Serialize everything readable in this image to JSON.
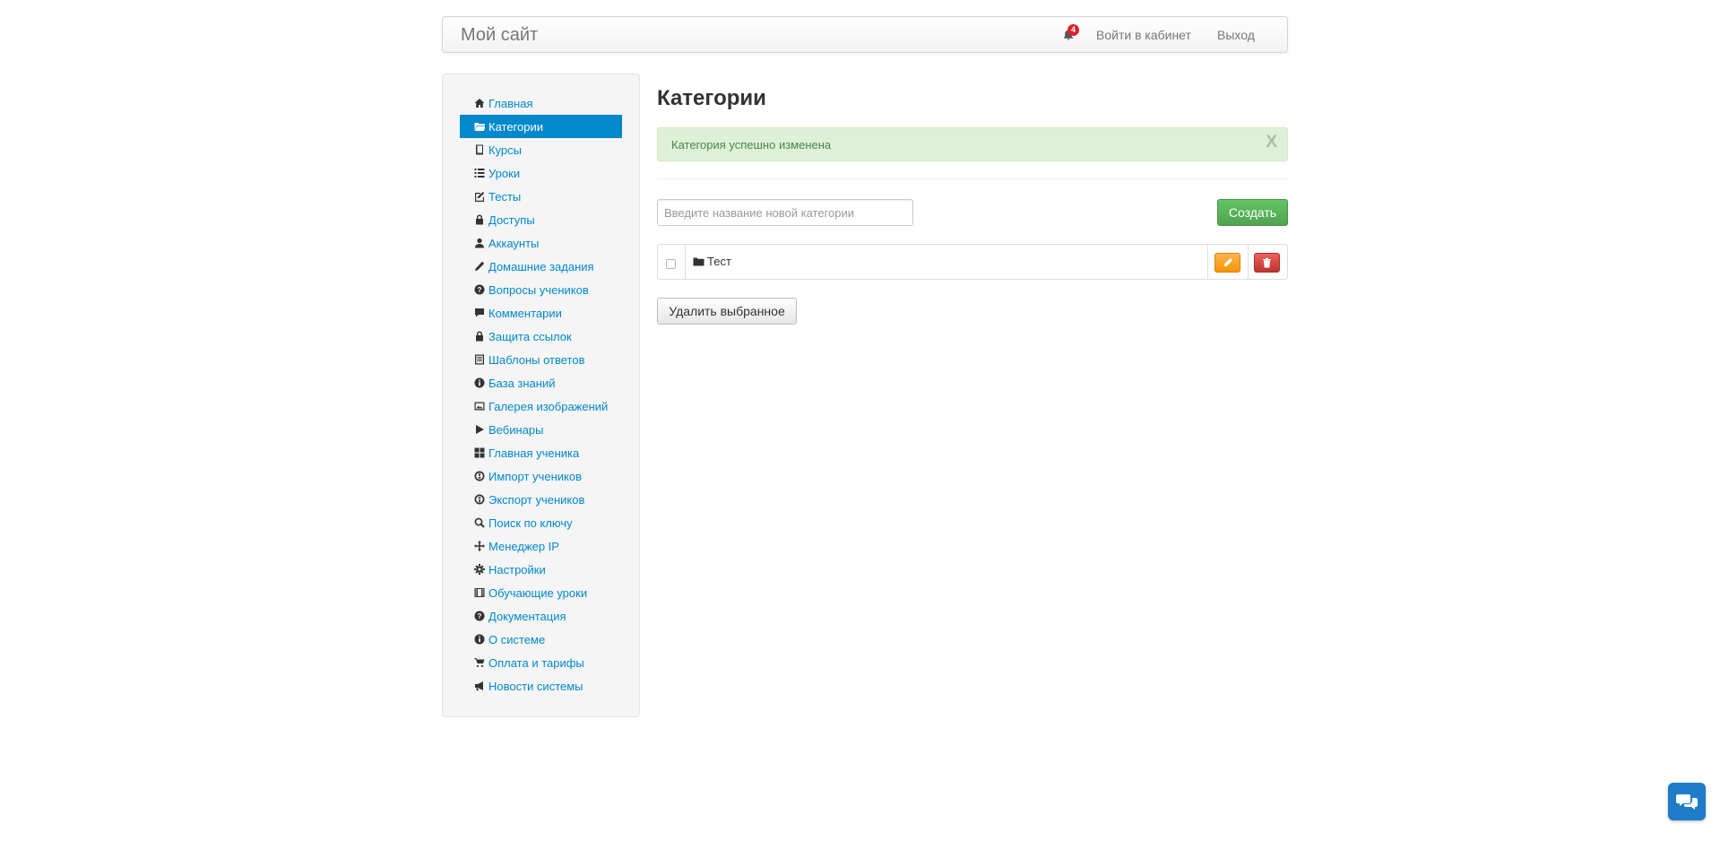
{
  "navbar": {
    "brand": "Мой сайт",
    "notification_count": "4",
    "login_label": "Войти в кабинет",
    "logout_label": "Выход"
  },
  "sidebar": {
    "items": [
      {
        "label": "Главная",
        "icon": "home-icon",
        "active": false
      },
      {
        "label": "Категории",
        "icon": "folder-open-icon",
        "active": true
      },
      {
        "label": "Курсы",
        "icon": "book-icon",
        "active": false
      },
      {
        "label": "Уроки",
        "icon": "list-icon",
        "active": false
      },
      {
        "label": "Тесты",
        "icon": "edit-check-icon",
        "active": false
      },
      {
        "label": "Доступы",
        "icon": "lock-icon",
        "active": false
      },
      {
        "label": "Аккаунты",
        "icon": "user-icon",
        "active": false
      },
      {
        "label": "Домашние задания",
        "icon": "pencil-icon",
        "active": false
      },
      {
        "label": "Вопросы учеников",
        "icon": "question-icon",
        "active": false
      },
      {
        "label": "Комментарии",
        "icon": "comment-icon",
        "active": false
      },
      {
        "label": "Защита ссылок",
        "icon": "lock-icon",
        "active": false
      },
      {
        "label": "Шаблоны ответов",
        "icon": "template-icon",
        "active": false
      },
      {
        "label": "База знаний",
        "icon": "info-icon",
        "active": false
      },
      {
        "label": "Галерея изображений",
        "icon": "picture-icon",
        "active": false
      },
      {
        "label": "Вебинары",
        "icon": "play-icon",
        "active": false
      },
      {
        "label": "Главная ученика",
        "icon": "grid-icon",
        "active": false
      },
      {
        "label": "Импорт учеников",
        "icon": "import-icon",
        "active": false
      },
      {
        "label": "Экспорт учеников",
        "icon": "export-icon",
        "active": false
      },
      {
        "label": "Поиск по ключу",
        "icon": "search-icon",
        "active": false
      },
      {
        "label": "Менеджер IP",
        "icon": "move-icon",
        "active": false
      },
      {
        "label": "Настройки",
        "icon": "gear-icon",
        "active": false
      },
      {
        "label": "Обучающие уроки",
        "icon": "film-icon",
        "active": false
      },
      {
        "label": "Документация",
        "icon": "question-icon",
        "active": false
      },
      {
        "label": "О системе",
        "icon": "info-icon",
        "active": false
      },
      {
        "label": "Оплата и тарифы",
        "icon": "cart-icon",
        "active": false
      },
      {
        "label": "Новости системы",
        "icon": "bullhorn-icon",
        "active": false
      }
    ]
  },
  "main": {
    "title": "Категории",
    "alert": {
      "text": "Категория успешно изменена",
      "close": "X"
    },
    "new_category": {
      "placeholder": "Введите название новой категории",
      "value": ""
    },
    "create_label": "Создать",
    "categories": [
      {
        "name": "Тест",
        "icon": "folder-icon"
      }
    ],
    "delete_selected_label": "Удалить выбранное"
  },
  "colors": {
    "link": "#0088cc",
    "active_bg": "#0088cc",
    "success_bg": "#dff0d8",
    "success_text": "#468847",
    "create_button": "#5bb75b",
    "edit_button": "#f89406",
    "delete_button": "#da4f49",
    "chat_widget": "#1e7cc8",
    "badge": "#d9232d"
  }
}
